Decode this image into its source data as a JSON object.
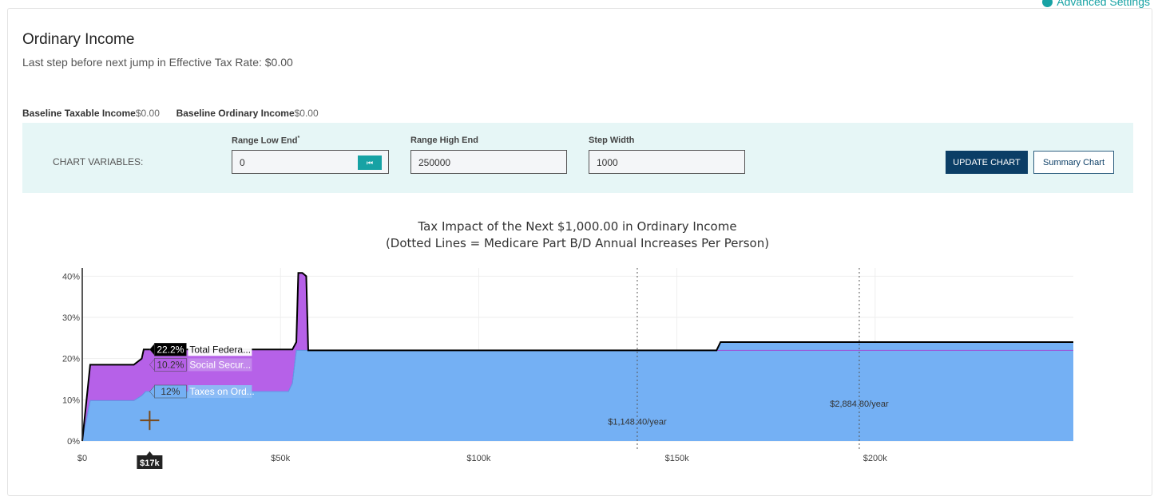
{
  "header": {
    "advanced_settings_label": "Advanced Settings",
    "title": "Ordinary Income",
    "subtitle": "Last step before next jump in Effective Tax Rate: $0.00"
  },
  "baseline": {
    "taxable_label": "Baseline Taxable Income",
    "taxable_value": "$0.00",
    "ordinary_label": "Baseline Ordinary Income",
    "ordinary_value": "$0.00"
  },
  "chart_variables": {
    "label": "CHART VARIABLES:",
    "range_low_label": "Range Low End",
    "range_low_marker": "*",
    "range_low_value": "0",
    "reset_glyph": "⏮",
    "range_high_label": "Range High End",
    "range_high_value": "250000",
    "step_width_label": "Step Width",
    "step_width_value": "1000",
    "update_button": "UPDATE CHART",
    "summary_button": "Summary Chart"
  },
  "icons": {
    "gear": "gear-icon",
    "reset": "skip-back-icon",
    "cursor": "crosshair-icon"
  },
  "colors": {
    "accent": "#17a2a4",
    "primary": "#0b3e66",
    "federal": "#000000",
    "social_security": "#b661e8",
    "ordinary": "#74b0f4"
  },
  "chart_data": {
    "type": "area",
    "title": "Tax Impact of the Next $1,000.00 in Ordinary Income",
    "subtitle": "(Dotted Lines = Medicare Part B/D Annual Increases Per Person)",
    "xlim": [
      0,
      250000
    ],
    "ylim": [
      0,
      42
    ],
    "x_ticks": [
      {
        "value": 0,
        "label": "$0"
      },
      {
        "value": 50000,
        "label": "$50k"
      },
      {
        "value": 100000,
        "label": "$100k"
      },
      {
        "value": 150000,
        "label": "$150k"
      },
      {
        "value": 200000,
        "label": "$200k"
      }
    ],
    "y_ticks": [
      {
        "value": 0,
        "label": "0%"
      },
      {
        "value": 10,
        "label": "10%"
      },
      {
        "value": 20,
        "label": "20%"
      },
      {
        "value": 30,
        "label": "30%"
      },
      {
        "value": 40,
        "label": "40%"
      }
    ],
    "grid": true,
    "series": [
      {
        "name": "Total Federa...",
        "color": "#000000",
        "points": [
          [
            0,
            0
          ],
          [
            2000,
            18.5
          ],
          [
            13000,
            18.5
          ],
          [
            15000,
            20
          ],
          [
            15500,
            22.2
          ],
          [
            23000,
            22.2
          ],
          [
            24000,
            22.2
          ],
          [
            53000,
            22.2
          ],
          [
            54000,
            24
          ],
          [
            54500,
            40.8
          ],
          [
            55500,
            40.8
          ],
          [
            56500,
            40
          ],
          [
            57000,
            22
          ],
          [
            160000,
            22
          ],
          [
            161000,
            24
          ],
          [
            250000,
            24
          ]
        ]
      },
      {
        "name": "Social Secur...",
        "color": "#b661e8",
        "points": [
          [
            0,
            0
          ],
          [
            2000,
            9.8
          ],
          [
            13000,
            9.8
          ],
          [
            15000,
            11
          ],
          [
            16000,
            12
          ],
          [
            52000,
            12
          ],
          [
            53000,
            14
          ],
          [
            54000,
            22
          ],
          [
            250000,
            22
          ]
        ]
      },
      {
        "name": "Taxes on Ord...",
        "color": "#74b0f4",
        "points": [
          [
            0,
            0
          ],
          [
            2000,
            9.8
          ],
          [
            13000,
            9.8
          ],
          [
            15000,
            11
          ],
          [
            16000,
            12
          ],
          [
            52000,
            12
          ],
          [
            53000,
            14
          ],
          [
            54000,
            22
          ],
          [
            160000,
            22
          ],
          [
            161000,
            24
          ],
          [
            250000,
            24
          ]
        ]
      }
    ],
    "hover": {
      "x_label": "$17k",
      "x": 17000,
      "items": [
        {
          "value_label": "22.2%",
          "name": "Total Federa...",
          "y": 22.2
        },
        {
          "value_label": "10.2%",
          "name": "Social Secur...",
          "y": 18.5
        },
        {
          "value_label": "12%",
          "name": "Taxes on Ord...",
          "y": 12
        }
      ]
    },
    "annotations": [
      {
        "x": 140000,
        "label": "$1,148.40/year",
        "label_y": 4
      },
      {
        "x": 196000,
        "label": "$2,884.80/year",
        "label_y": 8.3
      }
    ]
  }
}
